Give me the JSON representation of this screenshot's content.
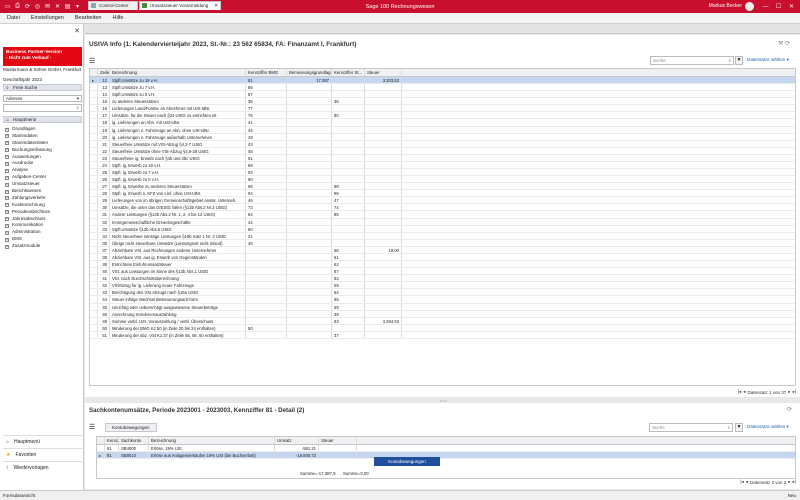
{
  "titlebar": {
    "title": "Sage 100 Rechnungswesen",
    "user": "Markus Becker"
  },
  "menu": [
    "Datei",
    "Einstellungen",
    "Bearbeiten",
    "Hilfe"
  ],
  "sidebar": {
    "promo_line1": "Business Partner-Version",
    "promo_line2": "- Nicht zum Verkauf -",
    "company": "Mustermann & Söhne GmbH, Frankfurt",
    "fiscal_year": "Geschäftsjahr 2023",
    "freesearch": "Freie Suche",
    "select_value": "Adresse",
    "mainmenu": "Hauptmenü",
    "tree": [
      "Grundlagen",
      "Stammdaten",
      "Stammdatenlisten",
      "Buchungserfassung",
      "Auswertungen",
      "Ausdrucke",
      "Analyse",
      "Aufgaben-Center",
      "Umsatzsteuer",
      "Berichtswesen",
      "Zahlungsverkehr",
      "Kostenrechnung",
      "Periodenabschluss",
      "Jahresabschluss",
      "Kommunikation",
      "Administration",
      "DMS",
      "Zusatzmodule"
    ],
    "nav": [
      "Hauptmenü",
      "Favoriten",
      "Wiedervorlagen"
    ]
  },
  "tabs": [
    "Control-Center",
    "Umsatzsteuer-Voranmeldung"
  ],
  "top": {
    "title": "UStVA Info (1. Kalendervierteljahr 2023, St.-Nr.: 23 562 65834, FA: Finanzamt I, Frankfurt)",
    "search_placeholder": "Suche",
    "datasets": "Datensätze wählen",
    "columns": [
      "Zeile",
      "Bezeichnung",
      "Kennziffer BMG",
      "Bemessungsgrundlage",
      "Kennziffer St...",
      "Steuer"
    ],
    "rows": [
      [
        "12",
        "Stpfl.Umsätze zu 19 v.H.",
        "81",
        "17.387",
        "",
        "3.303,53"
      ],
      [
        "13",
        "Stpfl.Umsätze zu 7 v.H.",
        "86",
        "",
        "",
        " "
      ],
      [
        "14",
        "Stpfl.Umsätze zu 0 v.H.",
        "87",
        "",
        "",
        ""
      ],
      [
        "15",
        "zu anderen Steuersätzen",
        "35",
        "",
        "36",
        ""
      ],
      [
        "16",
        "Lieferungen Land/Forstw. an Abnehmer mit USt-IdNr.",
        "77",
        "",
        "",
        ""
      ],
      [
        "17",
        "Umsätze, für die Steuer nach §24 UStG zu entrichten ist",
        "76",
        "",
        "80",
        ""
      ],
      [
        "18",
        "ig. Lieferungen an Abn. mit USt-IdNr.",
        "41",
        "",
        "",
        ""
      ],
      [
        "19",
        "ig. Lieferungen n. Fahrzeuge an Abn. ohne USt-IdNr.",
        "44",
        "",
        "",
        ""
      ],
      [
        "20",
        "ig. Lieferungen n. Fahrzeuge außerhalb Unternehmen",
        "49",
        "",
        "",
        ""
      ],
      [
        "21",
        "Steuerfreie Umsätze mit VSt-Abzug §4,2-7 UStG",
        "43",
        "",
        "",
        ""
      ],
      [
        "22",
        "Steuerfreie Umsätze ohne VSt-Abzug §4,8-28 UStG",
        "48",
        "",
        "",
        ""
      ],
      [
        "23",
        "Steuerfreier ig. Erwerb nach §4b und 25c UStG",
        "91",
        "",
        "",
        ""
      ],
      [
        "24",
        "Stpfl. ig. Erwerb zu 19 v.H.",
        "89",
        "",
        "",
        ""
      ],
      [
        "25",
        "Stpfl. ig. Erwerb zu 7 v.H.",
        "93",
        "",
        "",
        ""
      ],
      [
        "26",
        "Stpfl. ig. Erwerb zu 0 v.H.",
        "90",
        "",
        "",
        ""
      ],
      [
        "27",
        "Stpfl. ig. Erwerbe zu anderen Steuersätzen",
        "95",
        "",
        "98",
        ""
      ],
      [
        "28",
        "Stpfl. ig. Erwerb n. KFZ von Lief. ohne USt-IdNr.",
        "94",
        "",
        "96",
        ""
      ],
      [
        "29",
        "Lieferungen von im übrigen Gemeinschaftsgebiet ansäs. Unterneh.",
        "46",
        "",
        "47",
        ""
      ],
      [
        "30",
        "Umsätze, die unter das GrEStG fallen (§13b Abs.2 Nr.3 UStG)",
        "73",
        "",
        "74",
        ""
      ],
      [
        "31",
        "Andere Leistungen (§13b Abs.2 Nr. 1, 2, 4 bis 12 UStG)",
        "84",
        "",
        "85",
        ""
      ],
      [
        "32",
        "Innergemeinschaftliche Dreiecksgeschäfte",
        "42",
        "",
        "",
        ""
      ],
      [
        "33",
        "Stpfl.Umsätze §13b Abs.5 UStG",
        "60",
        "",
        "",
        ""
      ],
      [
        "34",
        "Nicht steuerbare sonstige Leistungen §18b Satz 1 Nr. 2 UStG",
        "21",
        "",
        "",
        ""
      ],
      [
        "35",
        "Übrige nicht steuerbare Umsätze (Leistungsort nicht Inland)",
        "45",
        "",
        "",
        ""
      ],
      [
        "37",
        "Abziehbare VSt. aus Rechnungen anderer Unternehmer",
        "",
        "",
        "66",
        "19,00"
      ],
      [
        "38",
        "Abziehbare VSt. aus ig. Erwerb von Gegenständen",
        "",
        "",
        "61",
        ""
      ],
      [
        "39",
        "Entrichtete Einfuhrumsatzsteuer",
        "",
        "",
        "62",
        ""
      ],
      [
        "40",
        "VSt. aus Leistungen im Sinne des §13b Abs.1 UStG",
        "",
        "",
        "67",
        ""
      ],
      [
        "41",
        "VSt. nach Durchschnittsberechnung",
        "",
        "",
        "63",
        ""
      ],
      [
        "42",
        "VStAbzug für ig. Lieferung neuer Fahrzeuge",
        "",
        "",
        "59",
        ""
      ],
      [
        "43",
        "Berichtigung des VSt.Abzugs nach §15a UStG",
        "",
        "",
        "64",
        ""
      ],
      [
        "44",
        "Steuer infolge Wechsel Besteuerungsart/-form",
        "",
        "",
        "65",
        ""
      ],
      [
        "45",
        "Unrichtig oder unberechtigt ausgewiesene Steuerbeträge",
        "",
        "",
        "69",
        ""
      ],
      [
        "46",
        "Anrechnung Sondervorauszahlung",
        "",
        "",
        "39",
        ""
      ],
      [
        "49",
        "Summe verbl. USt.-Vorauszahlung / verbl. Überschuss",
        "",
        "",
        "83",
        "3.284,53"
      ],
      [
        "50",
        "Minderung der BMG Kz.50 (in Zeile 20 bis 24 enthalten)",
        "50",
        "",
        "",
        ""
      ],
      [
        "51",
        "Minderung der abz. VSt Kz.37 (in Zeile 55, 56, 60 enthalten)",
        "",
        "",
        "37",
        ""
      ]
    ],
    "pager": "Datensatz 1 von 37"
  },
  "bottom": {
    "title": "Sachkontenumsätze, Periode 2023001 - 2023003, Kennziffer 81 - Detail (2)",
    "subtab": "Kontobewegungen",
    "search_placeholder": "Suche",
    "datasets": "Datensätze wählen",
    "columns": [
      "Kennziffer",
      "Sachkonto",
      "Bezeichnung",
      "Umsatz",
      "Steuer"
    ],
    "rows": [
      [
        "81",
        "SB4000",
        "Erlöse, 19% USt",
        "-581,21",
        ""
      ],
      [
        "81",
        "SB8010",
        "Erlöse aus Anlagenverkäufen 19% USt (bei Buchverlust)",
        "-16.806,72",
        ""
      ]
    ],
    "context_button": "Kontobewegungen",
    "sum_umsatz": "Summe=-17.387,9",
    "sum_steuer": "Summe=0,00",
    "pager": "Datensatz 2 von 2"
  },
  "status": {
    "left": "Formularansicht",
    "right": "Neu"
  },
  "colors": {
    "brand": "#c8102e",
    "selection": "#c5d6f0",
    "accent": "#1f4e9d"
  }
}
